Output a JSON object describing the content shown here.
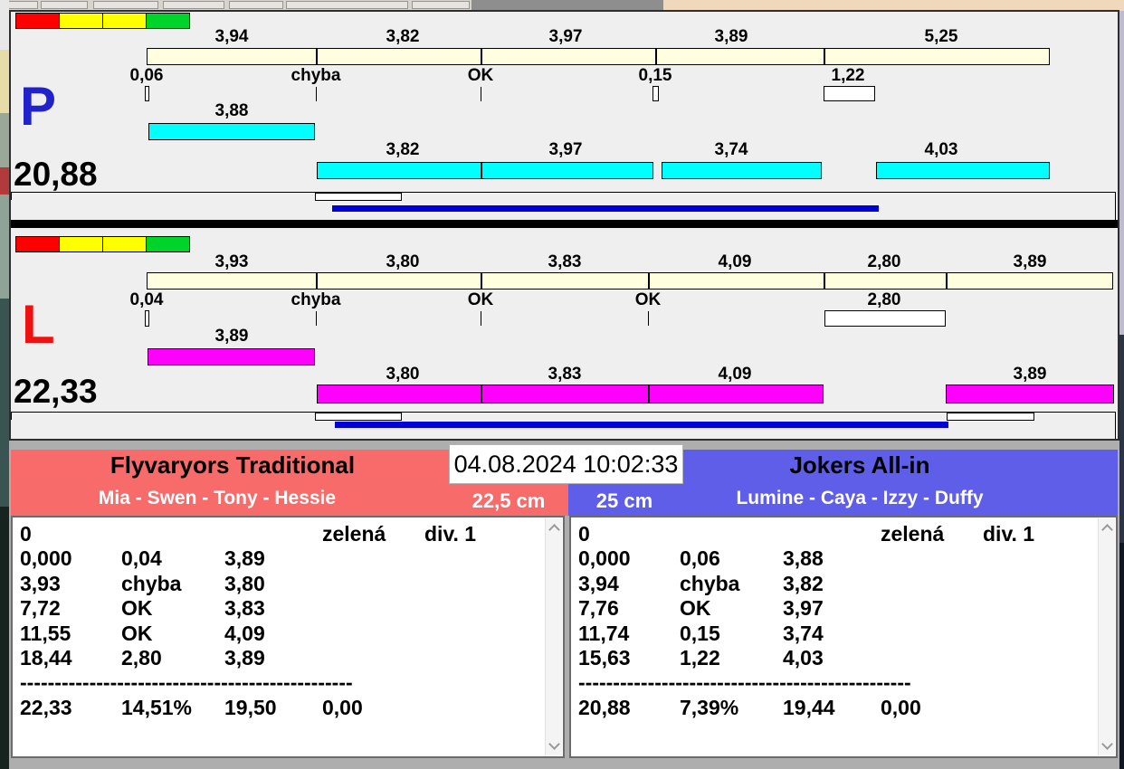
{
  "datetime": "04.08.2024 10:02:33",
  "colors": {
    "traffic_red": "#ff0000",
    "traffic_yellow": "#ffff00",
    "traffic_green": "#00d42a",
    "split_bar": "#ffffe0",
    "lane_p_letter": "#2222cc",
    "lane_p_bar": "#00ffff",
    "lane_l_letter": "#ee1111",
    "lane_l_bar": "#ff00ff",
    "progress_bar": "#0000d4",
    "team_left_bg": "#f86b6b",
    "team_right_bg": "#5e5ee9"
  },
  "lane_p": {
    "letter": "P",
    "total": "20,88",
    "splits": [
      "3,94",
      "3,82",
      "3,97",
      "3,89",
      "5,25"
    ],
    "marks": [
      "0,06",
      "chyba",
      "OK",
      "0,15",
      "1,22"
    ],
    "first_run": "3,88",
    "runs": [
      "3,82",
      "3,97",
      "3,74",
      "4,03"
    ]
  },
  "lane_l": {
    "letter": "L",
    "total": "22,33",
    "splits": [
      "3,93",
      "3,80",
      "3,83",
      "4,09",
      "2,80",
      "3,89"
    ],
    "marks": [
      "0,04",
      "chyba",
      "OK",
      "OK",
      "2,80"
    ],
    "first_run": "3,89",
    "runs": [
      "3,80",
      "3,83",
      "4,09",
      "3,89"
    ]
  },
  "team_left": {
    "name": "Flyvaryors Traditional",
    "members": "Mia - Swen - Tony - Hessie",
    "jump_height": "22,5 cm",
    "status": [
      "0",
      "zelená",
      "div. 1"
    ],
    "rows": [
      [
        "0,000",
        "0,04",
        "3,89"
      ],
      [
        "3,93",
        "chyba",
        "3,80"
      ],
      [
        "7,72",
        "OK",
        "3,83"
      ],
      [
        "11,55",
        "OK",
        "4,09"
      ],
      [
        "18,44",
        "2,80",
        "3,89"
      ]
    ],
    "separator": "------------------------------------------------",
    "totals": [
      "22,33",
      "14,51%",
      "19,50",
      "0,00"
    ]
  },
  "team_right": {
    "name": "Jokers All-in",
    "members": "Lumine - Caya - Izzy - Duffy",
    "jump_height": "25 cm",
    "status": [
      "0",
      "zelená",
      "div. 1"
    ],
    "rows": [
      [
        "0,000",
        "0,06",
        "3,88"
      ],
      [
        "3,94",
        "chyba",
        "3,82"
      ],
      [
        "7,76",
        "OK",
        "3,97"
      ],
      [
        "11,74",
        "0,15",
        "3,74"
      ],
      [
        "15,63",
        "1,22",
        "4,03"
      ]
    ],
    "separator": "------------------------------------------------",
    "totals": [
      "20,88",
      "7,39%",
      "19,44",
      "0,00"
    ]
  }
}
